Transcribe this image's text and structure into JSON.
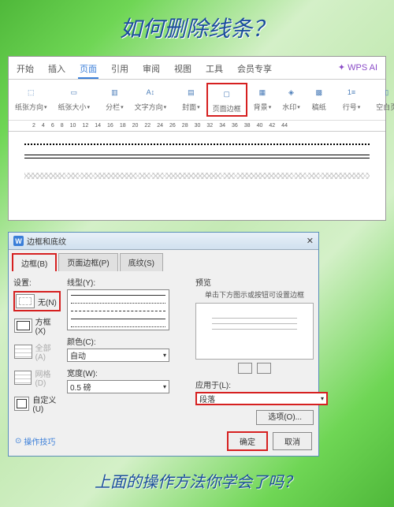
{
  "title": "如何删除线条？",
  "footer": "上面的操作方法你学会了吗？",
  "tabs": {
    "t1": "开始",
    "t2": "插入",
    "t3": "页面",
    "t4": "引用",
    "t5": "审阅",
    "t6": "视图",
    "t7": "工具",
    "t8": "会员专享",
    "ai": "✦ WPS AI"
  },
  "ribbon": {
    "r1": "纸张方向",
    "r2": "纸张大小",
    "r3": "分栏",
    "r4": "文字方向",
    "r5": "封面",
    "r6": "页面边框",
    "r7": "背景",
    "r8": "水印",
    "r9": "稿纸",
    "r10": "行号",
    "r11": "空白页"
  },
  "ruler": [
    "2",
    "4",
    "6",
    "8",
    "10",
    "12",
    "14",
    "16",
    "18",
    "20",
    "22",
    "24",
    "26",
    "28",
    "30",
    "32",
    "34",
    "36",
    "38",
    "40",
    "42",
    "44"
  ],
  "dialog": {
    "title": "边框和底纹",
    "tabs": {
      "t1": "边框(B)",
      "t2": "页面边框(P)",
      "t3": "底纹(S)"
    },
    "setting": "设置:",
    "opts": {
      "none": "无(N)",
      "box": "方框(X)",
      "all": "全部(A)",
      "grid": "网格(D)",
      "custom": "自定义(U)"
    },
    "linetype": "线型(Y):",
    "color": "颜色(C):",
    "colorval": "自动",
    "width": "宽度(W):",
    "widthval": "0.5 磅",
    "preview": "预览",
    "previewhint": "单击下方图示或按钮可设置边框",
    "applyto": "应用于(L):",
    "applytoval": "段落",
    "options": "选项(O)...",
    "tip": "操作技巧",
    "ok": "确定",
    "cancel": "取消"
  }
}
